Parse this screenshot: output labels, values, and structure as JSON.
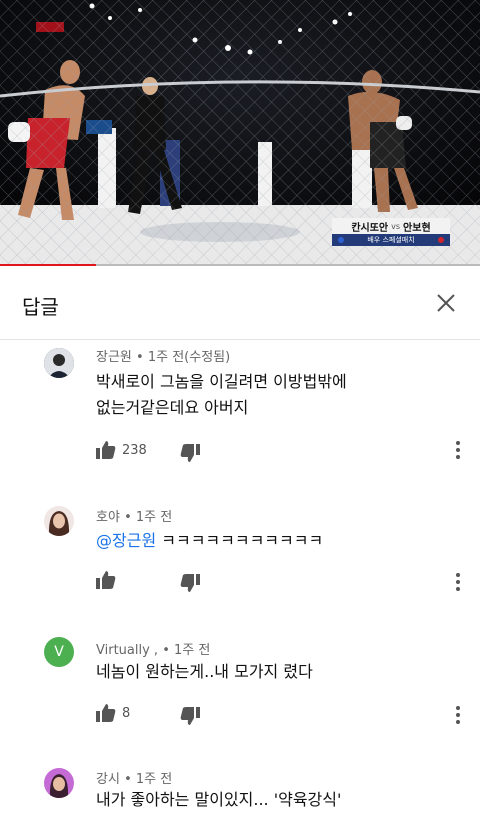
{
  "video": {
    "scorebug": {
      "fighter_left": "칸시또안",
      "vs": "vs",
      "fighter_right": "안보현",
      "subtitle": "배우 스페셜매치"
    },
    "progress": 0.2,
    "colors": {
      "progress": "#e0151b",
      "scorebug_sub": "#233b78"
    }
  },
  "panel": {
    "title": "답글",
    "close_icon": "close-icon"
  },
  "comments": [
    {
      "author": "장근원",
      "time": "1주 전(수정됨)",
      "mention": "",
      "lines": [
        "박새로이 그놈을 이길려면 이방법밖에",
        "없는거같은데요 아버지"
      ],
      "likes": "238"
    },
    {
      "author": "호야",
      "time": "1주 전",
      "mention": "@장근원",
      "lines": [
        "ㅋㅋㅋㅋㅋㅋㅋㅋㅋㅋㅋ"
      ],
      "likes": ""
    },
    {
      "author": "Virtually ,",
      "time": "1주 전",
      "avatar_letter": "V",
      "mention": "",
      "lines": [
        "네놈이 원하는게..내 모가지 렸다"
      ],
      "likes": "8"
    },
    {
      "author": "강시",
      "time": "1주 전",
      "mention": "",
      "lines": [
        "내가 좋아하는 말이있지... '약육강식'"
      ],
      "likes": ""
    }
  ],
  "separator": "•"
}
